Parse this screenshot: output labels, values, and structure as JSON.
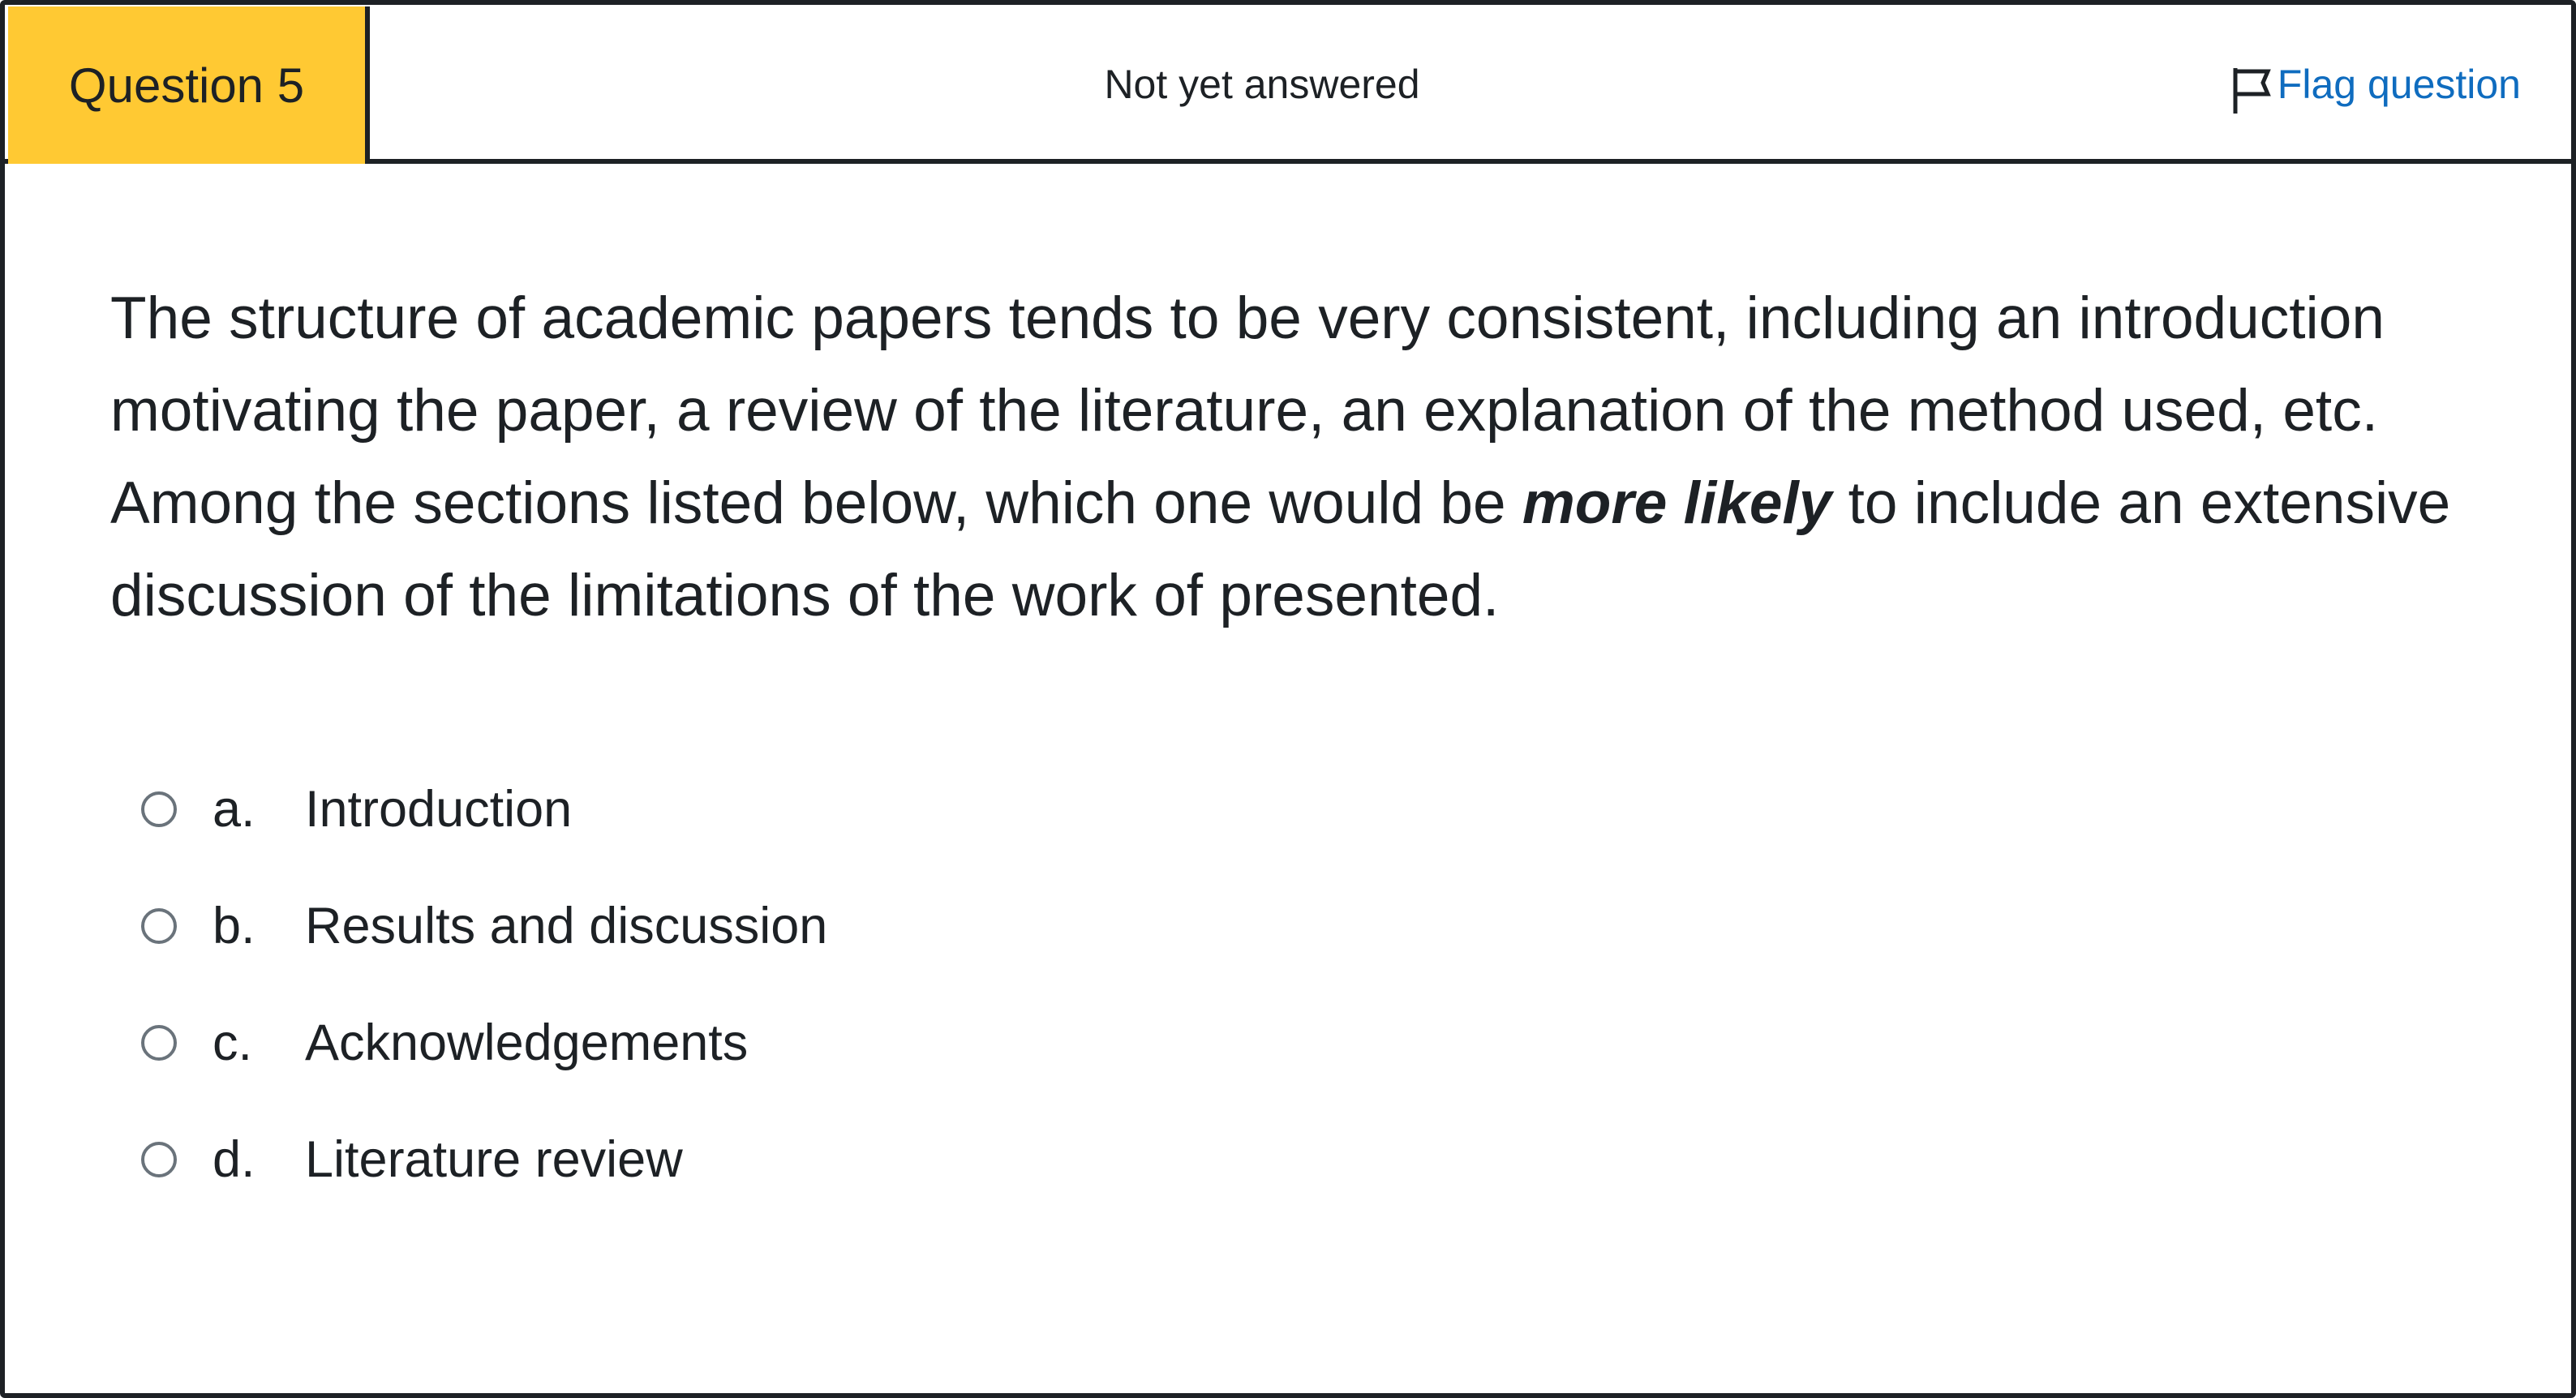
{
  "header": {
    "question_number": "Question 5",
    "state": "Not yet answered",
    "flag_label": "Flag question",
    "flag_icon": "flag-outline-icon"
  },
  "question": {
    "text_before": "The structure of academic papers tends to be very consistent, including an introduction motivating the paper, a review of the literature, an explanation of the method used, etc. Among the sections listed below, which one would be ",
    "emphasis": "more likely",
    "text_after": " to include an extensive discussion of the limitations of the work of presented."
  },
  "answers": [
    {
      "letter": "a.",
      "label": "Introduction",
      "selected": false
    },
    {
      "letter": "b.",
      "label": "Results and discussion",
      "selected": false
    },
    {
      "letter": "c.",
      "label": "Acknowledgements",
      "selected": false
    },
    {
      "letter": "d.",
      "label": "Literature review",
      "selected": false
    }
  ],
  "colors": {
    "question_number_bg": "#ffc933",
    "link": "#0f6cbf",
    "text": "#1d2125",
    "border": "#1d2125"
  }
}
